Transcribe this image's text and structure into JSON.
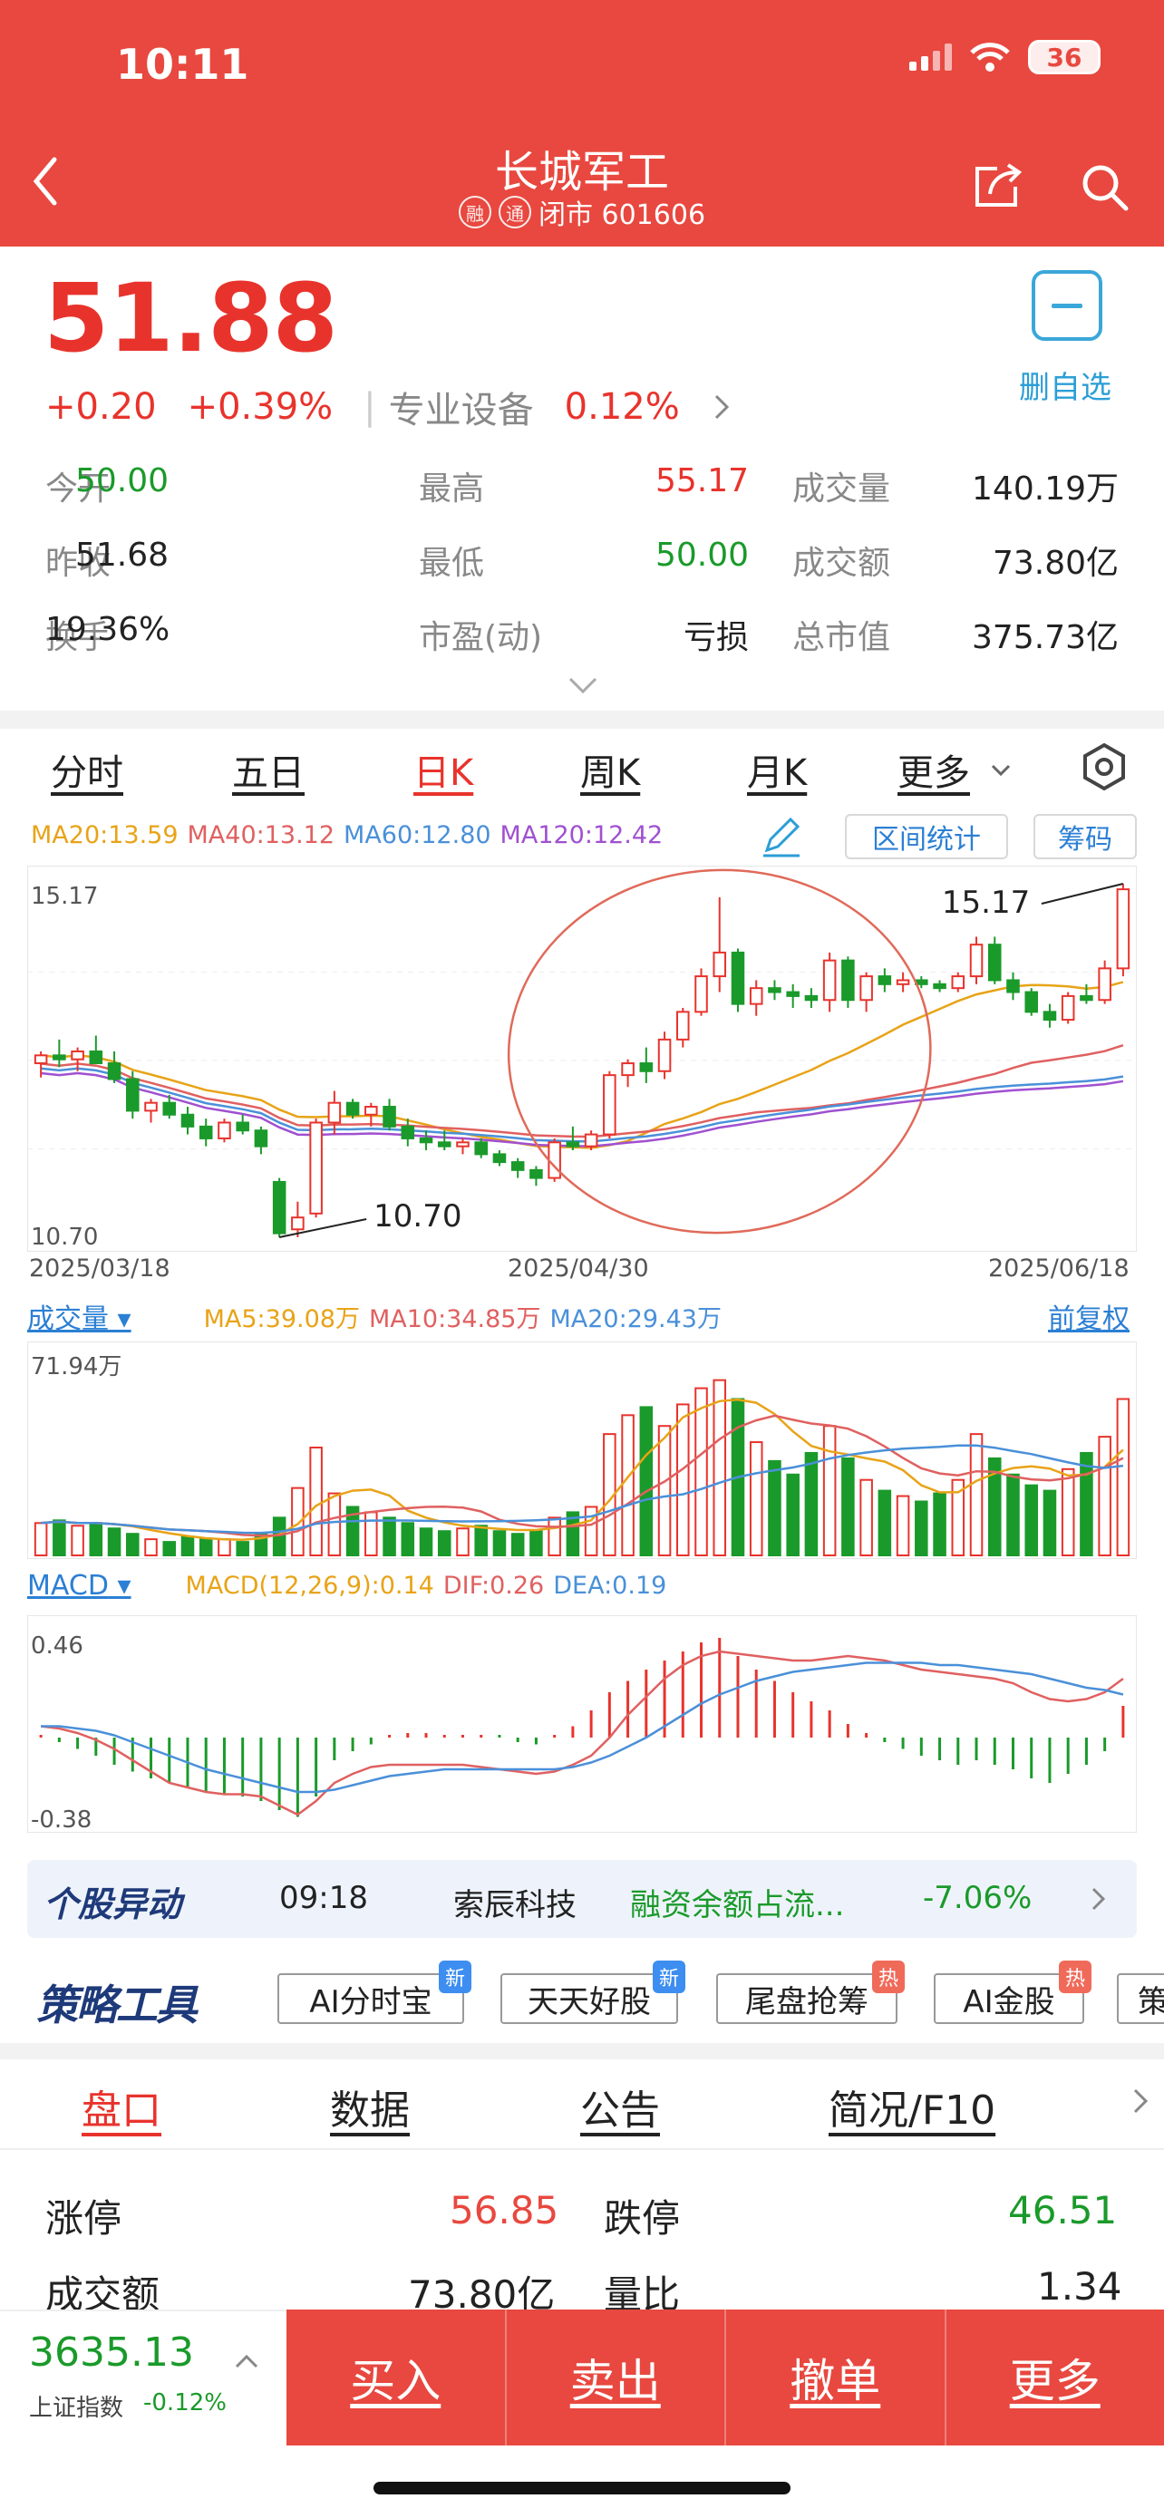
{
  "status": {
    "time": "10:11",
    "battery": "36"
  },
  "header": {
    "title": "长城军工",
    "tag1": "融",
    "tag2": "通",
    "status_text": "闭市 601606"
  },
  "quote": {
    "price": "51.88",
    "change": "+0.20",
    "change_pct": "+0.39%",
    "sector": "专业设备",
    "sector_pct": "0.12%",
    "watch_label": "删自选",
    "rows": [
      [
        {
          "l": "今开",
          "v": "50.00",
          "c": "green"
        },
        {
          "l": "最高",
          "v": "55.17",
          "c": "red"
        },
        {
          "l": "成交量",
          "v": "140.19万",
          "c": "black"
        }
      ],
      [
        {
          "l": "昨收",
          "v": "51.68",
          "c": "black"
        },
        {
          "l": "最低",
          "v": "50.00",
          "c": "green"
        },
        {
          "l": "成交额",
          "v": "73.80亿",
          "c": "black"
        }
      ],
      [
        {
          "l": "换手",
          "v": "19.36%",
          "c": "black"
        },
        {
          "l": "市盈(动)",
          "v": "亏损",
          "c": "black"
        },
        {
          "l": "总市值",
          "v": "375.73亿",
          "c": "black"
        }
      ]
    ]
  },
  "chart_tabs": [
    "分时",
    "五日",
    "日K",
    "周K",
    "月K",
    "更多"
  ],
  "active_tab": "日K",
  "ma": {
    "ma20": "MA20:13.59",
    "ma40": "MA40:13.12",
    "ma60": "MA60:12.80",
    "ma120": "MA120:12.42"
  },
  "colors": {
    "red": "#e8332c",
    "green": "#1a9a2a",
    "ma20": "#e8a317",
    "ma40": "#e06060",
    "ma60": "#4a90d9",
    "ma120": "#a050d0"
  },
  "buttons": {
    "range_stats": "区间统计",
    "chips": "筹码"
  },
  "kline": {
    "hi_label": "15.17",
    "lo_label": "10.70",
    "hi_callout": "15.17",
    "lo_callout": "10.70",
    "dates": [
      "2025/03/18",
      "2025/04/30",
      "2025/06/18"
    ]
  },
  "volume": {
    "label": "成交量",
    "ma5": "MA5:39.08万",
    "ma10": "MA10:34.85万",
    "ma20": "MA20:29.43万",
    "adjust": "前复权",
    "max_label": "71.94万"
  },
  "macd": {
    "label": "MACD",
    "params": "MACD(12,26,9):0.14",
    "dif": "DIF:0.26",
    "dea": "DEA:0.19",
    "top_label": "0.46",
    "bottom_label": "-0.38"
  },
  "chart_data": {
    "type": "candlestick",
    "x_range": [
      "2025/03/18",
      "2025/06/18"
    ],
    "ylim": [
      10.7,
      15.17
    ],
    "ohlc": [
      [
        12.9,
        13.05,
        12.72,
        13.0
      ],
      [
        13.0,
        13.2,
        12.85,
        12.95
      ],
      [
        12.95,
        13.1,
        12.8,
        13.05
      ],
      [
        13.05,
        13.25,
        12.9,
        12.9
      ],
      [
        12.9,
        13.05,
        12.65,
        12.7
      ],
      [
        12.7,
        12.8,
        12.2,
        12.3
      ],
      [
        12.3,
        12.45,
        12.15,
        12.4
      ],
      [
        12.4,
        12.5,
        12.2,
        12.25
      ],
      [
        12.25,
        12.35,
        12.0,
        12.1
      ],
      [
        12.1,
        12.2,
        11.85,
        11.95
      ],
      [
        11.95,
        12.2,
        11.9,
        12.15
      ],
      [
        12.15,
        12.25,
        12.0,
        12.05
      ],
      [
        12.05,
        12.1,
        11.75,
        11.85
      ],
      [
        11.4,
        11.45,
        10.7,
        10.75
      ],
      [
        10.8,
        11.15,
        10.7,
        10.95
      ],
      [
        11.0,
        12.2,
        10.95,
        12.15
      ],
      [
        12.15,
        12.55,
        12.0,
        12.4
      ],
      [
        12.4,
        12.45,
        12.2,
        12.25
      ],
      [
        12.25,
        12.4,
        12.1,
        12.35
      ],
      [
        12.35,
        12.45,
        12.05,
        12.1
      ],
      [
        12.1,
        12.2,
        11.85,
        11.95
      ],
      [
        11.95,
        12.05,
        11.8,
        11.9
      ],
      [
        11.9,
        12.05,
        11.8,
        11.85
      ],
      [
        11.85,
        11.95,
        11.75,
        11.9
      ],
      [
        11.9,
        11.95,
        11.7,
        11.75
      ],
      [
        11.75,
        11.8,
        11.6,
        11.65
      ],
      [
        11.65,
        11.7,
        11.45,
        11.55
      ],
      [
        11.55,
        11.6,
        11.35,
        11.45
      ],
      [
        11.45,
        11.95,
        11.4,
        11.9
      ],
      [
        11.9,
        12.1,
        11.8,
        11.85
      ],
      [
        11.85,
        12.05,
        11.8,
        12.0
      ],
      [
        12.0,
        12.8,
        11.95,
        12.75
      ],
      [
        12.75,
        12.95,
        12.6,
        12.9
      ],
      [
        12.9,
        13.1,
        12.65,
        12.8
      ],
      [
        12.8,
        13.3,
        12.7,
        13.2
      ],
      [
        13.2,
        13.6,
        13.1,
        13.55
      ],
      [
        13.55,
        14.1,
        13.5,
        14.0
      ],
      [
        14.0,
        15.0,
        13.8,
        14.3
      ],
      [
        14.3,
        14.35,
        13.55,
        13.65
      ],
      [
        13.65,
        13.95,
        13.5,
        13.85
      ],
      [
        13.85,
        13.95,
        13.7,
        13.8
      ],
      [
        13.8,
        13.9,
        13.6,
        13.75
      ],
      [
        13.75,
        13.85,
        13.6,
        13.7
      ],
      [
        13.7,
        14.3,
        13.55,
        14.2
      ],
      [
        14.2,
        14.25,
        13.6,
        13.7
      ],
      [
        13.7,
        14.05,
        13.55,
        14.0
      ],
      [
        14.0,
        14.1,
        13.8,
        13.9
      ],
      [
        13.9,
        14.05,
        13.8,
        13.95
      ],
      [
        13.95,
        14.0,
        13.85,
        13.9
      ],
      [
        13.9,
        13.95,
        13.8,
        13.85
      ],
      [
        13.85,
        14.05,
        13.8,
        14.0
      ],
      [
        14.0,
        14.5,
        13.9,
        14.4
      ],
      [
        14.4,
        14.5,
        13.9,
        13.95
      ],
      [
        13.95,
        14.05,
        13.7,
        13.8
      ],
      [
        13.8,
        13.85,
        13.5,
        13.55
      ],
      [
        13.55,
        13.65,
        13.35,
        13.45
      ],
      [
        13.45,
        13.8,
        13.4,
        13.75
      ],
      [
        13.75,
        13.9,
        13.65,
        13.7
      ],
      [
        13.7,
        14.2,
        13.65,
        14.1
      ],
      [
        14.1,
        15.17,
        14.0,
        15.1
      ]
    ],
    "volume_ylim": [
      0,
      71.94
    ],
    "volume": [
      12,
      13,
      11,
      12,
      10,
      8,
      6,
      5,
      7,
      6,
      6,
      5,
      8,
      14,
      25,
      40,
      23,
      18,
      16,
      14,
      12,
      10,
      9,
      10,
      11,
      9,
      8,
      9,
      14,
      16,
      18,
      45,
      52,
      55,
      48,
      56,
      62,
      65,
      58,
      42,
      35,
      30,
      38,
      48,
      36,
      28,
      24,
      22,
      20,
      23,
      28,
      45,
      36,
      30,
      26,
      24,
      32,
      38,
      44,
      58
    ],
    "macd_ylim": [
      -0.38,
      0.46
    ],
    "macd_hist": [
      0.0,
      -0.02,
      -0.05,
      -0.08,
      -0.12,
      -0.15,
      -0.18,
      -0.2,
      -0.22,
      -0.24,
      -0.25,
      -0.26,
      -0.28,
      -0.32,
      -0.35,
      -0.26,
      -0.1,
      -0.06,
      -0.03,
      0.01,
      0.02,
      0.02,
      0.01,
      0.01,
      0.0,
      -0.01,
      -0.02,
      -0.03,
      0.0,
      0.05,
      0.12,
      0.2,
      0.25,
      0.3,
      0.34,
      0.38,
      0.42,
      0.44,
      0.36,
      0.3,
      0.25,
      0.2,
      0.16,
      0.12,
      0.06,
      0.02,
      -0.02,
      -0.05,
      -0.08,
      -0.1,
      -0.12,
      -0.1,
      -0.12,
      -0.14,
      -0.18,
      -0.2,
      -0.16,
      -0.12,
      -0.06,
      0.14
    ],
    "dif": [
      0.05,
      0.04,
      0.02,
      -0.01,
      -0.05,
      -0.1,
      -0.15,
      -0.2,
      -0.22,
      -0.24,
      -0.25,
      -0.25,
      -0.26,
      -0.3,
      -0.34,
      -0.28,
      -0.2,
      -0.16,
      -0.13,
      -0.12,
      -0.12,
      -0.12,
      -0.12,
      -0.12,
      -0.13,
      -0.14,
      -0.15,
      -0.16,
      -0.15,
      -0.12,
      -0.08,
      0.0,
      0.1,
      0.18,
      0.26,
      0.32,
      0.36,
      0.38,
      0.37,
      0.36,
      0.35,
      0.34,
      0.34,
      0.35,
      0.36,
      0.35,
      0.34,
      0.32,
      0.3,
      0.29,
      0.28,
      0.27,
      0.26,
      0.24,
      0.2,
      0.17,
      0.16,
      0.17,
      0.2,
      0.26
    ],
    "dea": [
      0.05,
      0.05,
      0.04,
      0.03,
      0.01,
      -0.02,
      -0.05,
      -0.08,
      -0.11,
      -0.14,
      -0.16,
      -0.18,
      -0.2,
      -0.22,
      -0.24,
      -0.24,
      -0.23,
      -0.21,
      -0.19,
      -0.17,
      -0.16,
      -0.15,
      -0.14,
      -0.14,
      -0.14,
      -0.14,
      -0.14,
      -0.14,
      -0.14,
      -0.13,
      -0.11,
      -0.08,
      -0.04,
      0.0,
      0.05,
      0.1,
      0.15,
      0.19,
      0.22,
      0.25,
      0.27,
      0.29,
      0.3,
      0.31,
      0.32,
      0.33,
      0.33,
      0.33,
      0.33,
      0.32,
      0.32,
      0.31,
      0.3,
      0.29,
      0.28,
      0.26,
      0.24,
      0.22,
      0.21,
      0.19
    ]
  },
  "banner": {
    "logo": "个股异动",
    "time": "09:18",
    "name": "索辰科技",
    "text": "融资余额占流...",
    "pct": "-7.06%"
  },
  "strategy": {
    "logo": "策略工具",
    "chips": [
      {
        "t": "AI分时宝",
        "b": "新",
        "bc": "blue"
      },
      {
        "t": "天天好股",
        "b": "新",
        "bc": "blue"
      },
      {
        "t": "尾盘抢筹",
        "b": "热",
        "bc": "red"
      },
      {
        "t": "AI金股",
        "b": "热",
        "bc": "red"
      },
      {
        "t": "策",
        "b": "",
        "bc": ""
      }
    ]
  },
  "bottom_tabs": [
    "盘口",
    "数据",
    "公告",
    "简况/F10"
  ],
  "limits": {
    "up_label": "涨停",
    "up_val": "56.85",
    "down_label": "跌停",
    "down_val": "46.51",
    "amt_label": "成交额",
    "amt_val": "73.80亿",
    "ratio_label": "量比",
    "ratio_val": "1.34"
  },
  "footer": {
    "index_val": "3635.13",
    "index_label": "上证指数",
    "index_chg": "-0.12%",
    "buttons": [
      "买入",
      "卖出",
      "撤单",
      "更多"
    ]
  }
}
